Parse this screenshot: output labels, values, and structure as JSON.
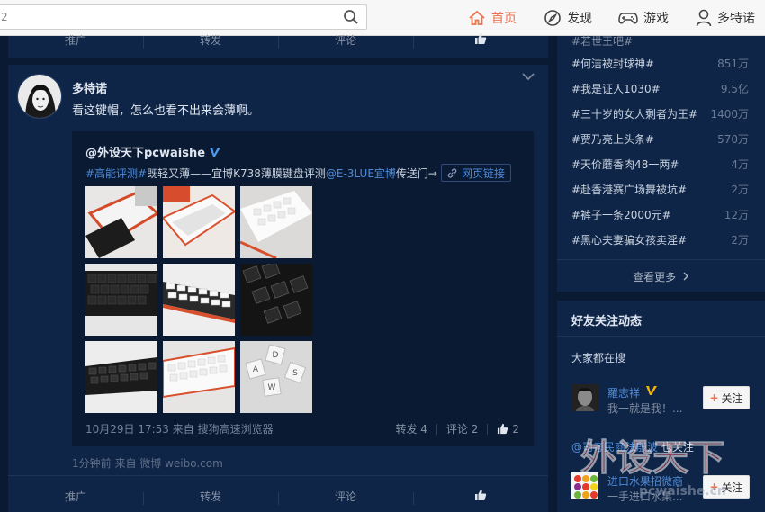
{
  "search": {
    "value": "2",
    "placeholder": ""
  },
  "nav": {
    "home": "首页",
    "discover": "发现",
    "games": "游戏",
    "user": "多特诺"
  },
  "prev_actions": {
    "promote": "推广",
    "repost": "转发",
    "comment": "评论"
  },
  "post": {
    "author": "多特诺",
    "text": "看这键帽，怎么也看不出来会薄啊。",
    "repost": {
      "user": "@外设天下pcwaishe",
      "topic": "#高能评测#",
      "body": "既轻又薄——宜博K738薄膜键盘评测",
      "mention": "@E-3LUE宜博",
      "tail": " 传送门→",
      "link_label": "网页链接",
      "date": "10月29日 17:53 来自 ",
      "source": "搜狗高速浏览器",
      "repost_count": "转发 4",
      "comment_count": "评论 2",
      "like_count": "2"
    },
    "time": "1分钟前 来自 ",
    "time_source": "微博 weibo.com",
    "actions": {
      "promote": "推广",
      "repost": "转发",
      "comment": "评论"
    }
  },
  "hot": {
    "top_partial": "#若世王吧#",
    "items": [
      {
        "title": "#何洁被封球神#",
        "count": "851万"
      },
      {
        "title": "#我是证人1030#",
        "count": "9.5亿"
      },
      {
        "title": "#三十岁的女人剩者为王#",
        "count": "1400万"
      },
      {
        "title": "#贾乃亮上头条#",
        "count": "570万"
      },
      {
        "title": "#天价蘑香肉48一两#",
        "count": "4万"
      },
      {
        "title": "#赴香港赛广场舞被坑#",
        "count": "2万"
      },
      {
        "title": "#裤子一条2000元#",
        "count": "12万"
      },
      {
        "title": "#黑心夫妻骗女孩卖淫#",
        "count": "2万"
      }
    ],
    "see_more": "查看更多"
  },
  "friends": {
    "title": "好友关注动态",
    "subtitle": "大家都在搜",
    "people": [
      {
        "name": "羅志祥",
        "desc": "我一就是我！...",
        "follow": "关注"
      },
      {
        "name": "进口水果招微商",
        "desc": "一手进口水果...",
        "follow": "关注"
      }
    ],
    "note_link": "@司考民商法殷波",
    "note_text": " 也关注"
  },
  "watermark": {
    "line1": "外设天下",
    "line2": "pcwaishe.cn"
  },
  "colors": {
    "accent": "#eb7350",
    "link": "#4d8bd9",
    "bg": "#0b1a33",
    "card": "#0f2547"
  }
}
